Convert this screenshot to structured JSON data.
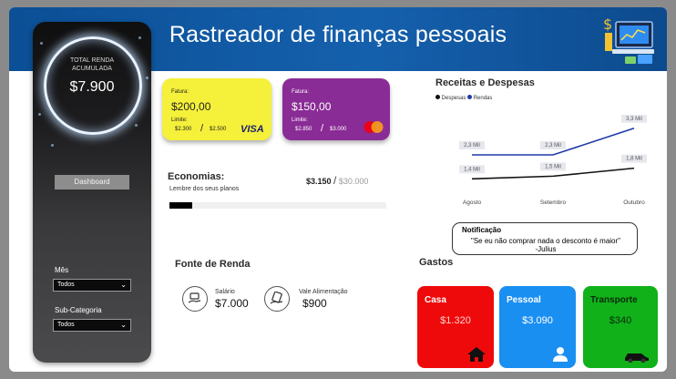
{
  "header": {
    "title": "Rastreador de finanças pessoais"
  },
  "sidebar": {
    "total_label_line1": "TOTAL RENDA",
    "total_label_line2": "ACUMULADA",
    "total_value": "$7.900",
    "dashboard_button": "Dashboard",
    "filters": [
      {
        "label": "Mês",
        "value": "Todos"
      },
      {
        "label": "Sub-Categoria",
        "value": "Todos"
      }
    ]
  },
  "cards": [
    {
      "invoice_label": "Fatura:",
      "invoice_value": "$200,00",
      "limit_label": "Limite:",
      "limit_used": "$2.300",
      "limit_total": "$2.500",
      "brand": "VISA",
      "color": "#f5f03a"
    },
    {
      "invoice_label": "Fatura:",
      "invoice_value": "$150,00",
      "limit_label": "Limite:",
      "limit_used": "$2.850",
      "limit_total": "$3.000",
      "brand": "mastercard-icon",
      "color": "#8a2c95"
    }
  ],
  "savings": {
    "title": "Economias:",
    "subtitle": "Lembre dos seus planos",
    "current": "$3.150",
    "separator": "/",
    "goal": "$30.000",
    "progress": 0.105
  },
  "income": {
    "title": "Fonte de Renda",
    "items": [
      {
        "label": "Salário",
        "value": "$7.000",
        "icon": "salary-hand-icon"
      },
      {
        "label": "Vale Alimentação",
        "value": "$900",
        "icon": "card-hand-icon"
      }
    ]
  },
  "chart_data": {
    "type": "line",
    "title": "Receitas e Despesas",
    "categories": [
      "Agosto",
      "Setembro",
      "Outubro"
    ],
    "series": [
      {
        "name": "Despesas",
        "values": [
          1.4,
          1.5,
          1.8
        ],
        "labels": [
          "1,4 Mil",
          "1,5 Mil",
          "1,8 Mil"
        ],
        "color": "#111111"
      },
      {
        "name": "Rendas",
        "values": [
          2.3,
          2.3,
          3.3
        ],
        "labels": [
          "2,3 Mil",
          "2,3 Mil",
          "3,3 Mil"
        ],
        "color": "#1f3aa8"
      }
    ],
    "ylim": [
      1.0,
      3.6
    ],
    "legend": "top-left",
    "grid": false
  },
  "notification": {
    "title": "Notificação",
    "quote": "\"Se eu não comprar nada o desconto é maior\"",
    "author": "-Julius"
  },
  "expenses": {
    "title": "Gastos",
    "items": [
      {
        "label": "Casa",
        "value": "$1.320",
        "color": "#ee0a0a",
        "icon": "house-icon"
      },
      {
        "label": "Pessoal",
        "value": "$3.090",
        "color": "#1a8ff2",
        "icon": "person-icon"
      },
      {
        "label": "Transporte",
        "value": "$340",
        "color": "#11b11a",
        "icon": "car-icon"
      }
    ]
  }
}
